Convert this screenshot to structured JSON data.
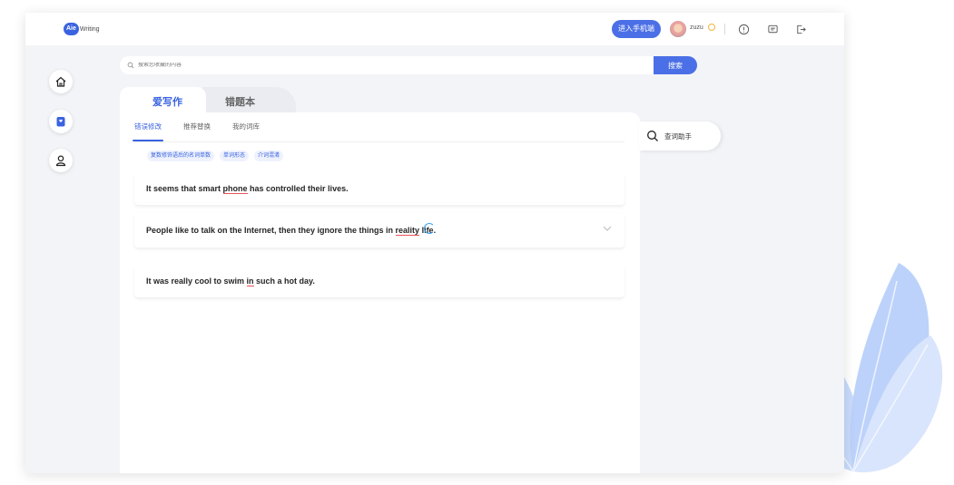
{
  "header": {
    "logo_badge": "Aie",
    "logo_text": "Writing",
    "mobile_button": "进入手机端",
    "username": "zuzu"
  },
  "search": {
    "placeholder": "搜索您收藏的内容",
    "button": "搜索"
  },
  "main_tabs": [
    {
      "label": "爱写作",
      "active": true
    },
    {
      "label": "错题本",
      "active": false
    }
  ],
  "sub_tabs": [
    {
      "label": "错误修改",
      "active": true
    },
    {
      "label": "推荐替换",
      "active": false
    },
    {
      "label": "我的词库",
      "active": false
    }
  ],
  "tags": [
    "复数修饰语后的名词单数",
    "单词形态",
    "介词混淆"
  ],
  "sentences": [
    {
      "before": "It seems that smart ",
      "error": "phone",
      "after": " has controlled their lives."
    },
    {
      "before": "People like to talk on the Internet, then they ignore the things in ",
      "error": "reality",
      "after": " life."
    },
    {
      "before": "It was really cool to swim ",
      "error": "in",
      "after": " such a hot day."
    }
  ],
  "helper": {
    "label": "查词助手"
  },
  "colors": {
    "accent": "#3a63e0",
    "button": "#4b6fe6",
    "error_underline": "#e8535b"
  }
}
